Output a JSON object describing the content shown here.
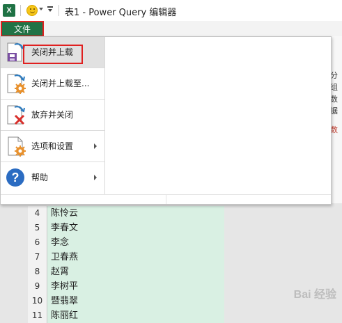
{
  "app": {
    "icon_letter": "X",
    "window_title": "表1 - Power Query 编辑器"
  },
  "file_tab": {
    "label": "文件"
  },
  "file_menu": {
    "items": [
      {
        "label": "关闭并上载",
        "icon": "close-and-load-icon",
        "active": true,
        "submenu": false
      },
      {
        "label": "关闭并上载至...",
        "icon": "close-and-load-to-icon",
        "active": false,
        "submenu": false
      },
      {
        "label": "放弃并关闭",
        "icon": "discard-and-close-icon",
        "active": false,
        "submenu": false
      },
      {
        "label": "选项和设置",
        "icon": "options-settings-icon",
        "active": false,
        "submenu": true
      },
      {
        "label": "帮助",
        "icon": "help-icon",
        "active": false,
        "submenu": true
      }
    ]
  },
  "background": {
    "ribbon_partial_text": [
      "分组",
      "数据"
    ],
    "ribbon_partial_text_red": "数"
  },
  "grid": {
    "rows": [
      {
        "num": "4",
        "value": "陈怜云"
      },
      {
        "num": "5",
        "value": "李春文"
      },
      {
        "num": "6",
        "value": "李念"
      },
      {
        "num": "7",
        "value": "卫春燕"
      },
      {
        "num": "8",
        "value": "赵霄"
      },
      {
        "num": "9",
        "value": "李树平"
      },
      {
        "num": "10",
        "value": "暨翡翠"
      },
      {
        "num": "11",
        "value": "陈丽红"
      }
    ]
  },
  "watermark": "Bai 经验",
  "colors": {
    "file_tab_bg": "#217346",
    "highlight_red": "#e02020",
    "grid_cell_bg": "#d9f0e3",
    "active_item_bg": "#e1e1e1"
  }
}
